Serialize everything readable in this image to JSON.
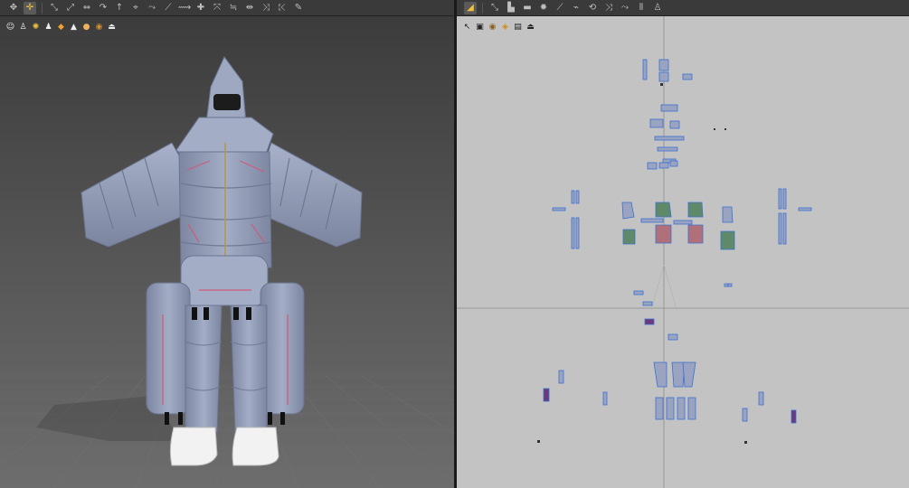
{
  "toolbar_3d": {
    "icons": [
      "select-icon",
      "transform-icon",
      "edit-point-icon",
      "edit-curve-icon",
      "fold-icon",
      "sewing-icon",
      "arrow-icon",
      "pin-icon",
      "tack-icon",
      "segment-sew-icon",
      "free-sew-icon",
      "check-sew-icon",
      "brush-icon",
      "measure-icon",
      "ruler-icon",
      "tape-icon",
      "line-icon",
      "magic-icon"
    ],
    "active_index": 1
  },
  "subbar_3d": {
    "icons": [
      "avatar-view-icon",
      "garment-icon",
      "texture-icon",
      "person-icon",
      "material-icon",
      "lock-icon",
      "skin-icon",
      "globe-icon",
      "export-icon"
    ]
  },
  "toolbar_2d": {
    "icons": [
      "pattern-select-icon",
      "edit-pattern-icon",
      "polygon-icon",
      "rectangle-icon",
      "sun-icon",
      "internal-line-icon",
      "segment-icon",
      "seam-icon",
      "fold-line-icon",
      "chain-icon",
      "stitch-icon",
      "shirt-icon"
    ],
    "active_index": 0
  },
  "subbar_2d": {
    "icons": [
      "pattern-tool-icon",
      "layer-icon",
      "texture-2d-icon",
      "grade-icon",
      "fold-2d-icon",
      "export-2d-icon"
    ]
  },
  "colors": {
    "garment": "#8f9ab2",
    "garment_dark": "#6f7a92",
    "pattern_fill": "#9aa3c0",
    "pattern_outline": "#3c6fd2",
    "pattern_glow": "#7fb3ff",
    "floor_grid": "#6f6f6f",
    "shoe": "#f2f2f2",
    "view_2d_bg": "#c3c3c3"
  }
}
